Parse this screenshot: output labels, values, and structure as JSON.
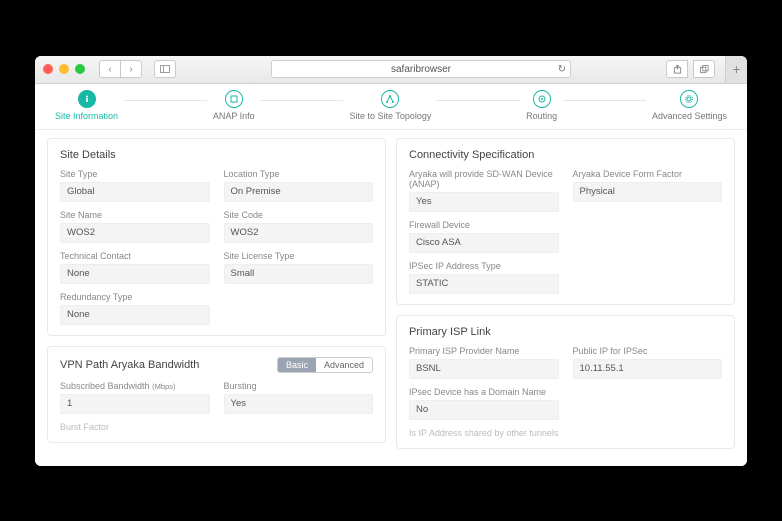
{
  "browser": {
    "address": "safaribrowser"
  },
  "stepper": {
    "steps": [
      {
        "label": "Site Information"
      },
      {
        "label": "ANAP Info"
      },
      {
        "label": "Site to Site Topology"
      },
      {
        "label": "Routing"
      },
      {
        "label": "Advanced Settings"
      }
    ]
  },
  "siteDetails": {
    "title": "Site Details",
    "siteType": {
      "label": "Site Type",
      "value": "Global"
    },
    "locationType": {
      "label": "Location Type",
      "value": "On Premise"
    },
    "siteName": {
      "label": "Site Name",
      "value": "WOS2"
    },
    "siteCode": {
      "label": "Site Code",
      "value": "WOS2"
    },
    "technicalContact": {
      "label": "Technical Contact",
      "value": "None"
    },
    "siteLicenseType": {
      "label": "Site License Type",
      "value": "Small"
    },
    "redundancyType": {
      "label": "Redundancy Type",
      "value": "None"
    }
  },
  "vpn": {
    "title": "VPN Path Aryaka Bandwidth",
    "seg": {
      "basic": "Basic",
      "advanced": "Advanced"
    },
    "subscribed": {
      "label": "Subscribed Bandwidth",
      "unit": "(Mbps)",
      "value": "1"
    },
    "bursting": {
      "label": "Bursting",
      "value": "Yes"
    },
    "burstFactor": {
      "label": "Burst Factor"
    }
  },
  "connectivity": {
    "title": "Connectivity Specification",
    "anapProvide": {
      "label": "Aryaka will provide SD-WAN Device (ANAP)",
      "value": "Yes"
    },
    "formFactor": {
      "label": "Aryaka Device Form Factor",
      "value": "Physical"
    },
    "firewall": {
      "label": "Firewall Device",
      "value": "Cisco ASA"
    },
    "ipsecType": {
      "label": "IPSec IP Address Type",
      "value": "STATIC"
    }
  },
  "primaryIsp": {
    "title": "Primary ISP Link",
    "provider": {
      "label": "Primary ISP Provider Name",
      "value": "BSNL"
    },
    "publicIp": {
      "label": "Public IP for IPSec",
      "value": "10.11.55.1"
    },
    "domain": {
      "label": "IPsec Device has a Domain Name",
      "value": "No"
    },
    "shared": {
      "label": "Is IP Address shared by other tunnels"
    }
  }
}
